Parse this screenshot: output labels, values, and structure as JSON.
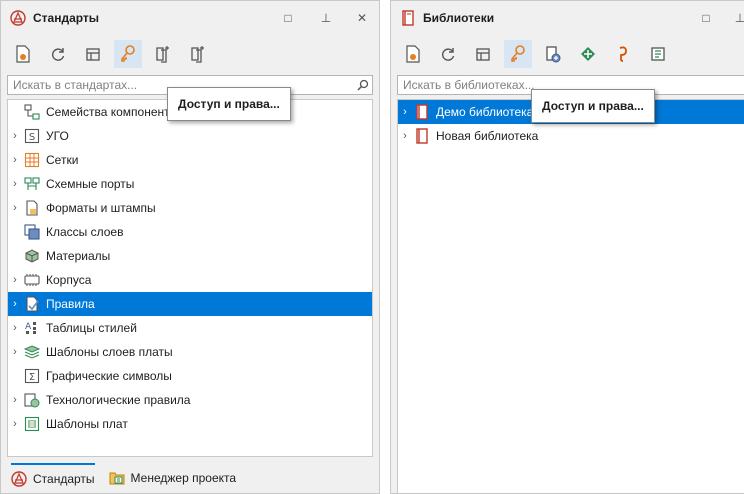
{
  "colors": {
    "accent": "#0078d7",
    "selection": "#0078d7",
    "tooltip_border": "#8a8a8a"
  },
  "left_panel": {
    "title": "Стандарты",
    "title_icon": "standards-icon",
    "window_buttons": {
      "maximize": "□",
      "pin": "⊥",
      "close": "✕"
    },
    "toolbar": [
      "new-icon",
      "refresh-icon",
      "collapse-icon",
      "key-icon",
      "add-standard-icon",
      "add-copy-icon"
    ],
    "search": {
      "placeholder": "Искать в стандартах...",
      "value": ""
    },
    "tree": [
      {
        "label": "Семейства компонентов",
        "expandable": false,
        "icon": "family-icon",
        "selected": false
      },
      {
        "label": "УГО",
        "expandable": true,
        "icon": "symbol-s-icon",
        "selected": false
      },
      {
        "label": "Сетки",
        "expandable": true,
        "icon": "grid-icon",
        "selected": false
      },
      {
        "label": "Схемные порты",
        "expandable": true,
        "icon": "ports-icon",
        "selected": false
      },
      {
        "label": "Форматы и штампы",
        "expandable": true,
        "icon": "format-icon",
        "selected": false
      },
      {
        "label": "Классы слоев",
        "expandable": false,
        "icon": "layer-class-icon",
        "selected": false
      },
      {
        "label": "Материалы",
        "expandable": false,
        "icon": "material-icon",
        "selected": false
      },
      {
        "label": "Корпуса",
        "expandable": true,
        "icon": "package-icon",
        "selected": false
      },
      {
        "label": "Правила",
        "expandable": true,
        "icon": "rules-icon",
        "selected": true
      },
      {
        "label": "Таблицы стилей",
        "expandable": true,
        "icon": "style-table-icon",
        "selected": false
      },
      {
        "label": "Шаблоны слоев платы",
        "expandable": true,
        "icon": "layer-stack-icon",
        "selected": false
      },
      {
        "label": "Графические символы",
        "expandable": false,
        "icon": "sigma-icon",
        "selected": false
      },
      {
        "label": "Технологические правила",
        "expandable": true,
        "icon": "tech-rules-icon",
        "selected": false
      },
      {
        "label": "Шаблоны плат",
        "expandable": true,
        "icon": "board-template-icon",
        "selected": false
      }
    ],
    "tooltip": "Доступ и права...",
    "tabs": [
      {
        "label": "Стандарты",
        "icon": "standards-icon",
        "active": true
      },
      {
        "label": "Менеджер проекта",
        "icon": "project-manager-icon",
        "active": false
      }
    ]
  },
  "right_panel": {
    "title": "Библиотеки",
    "title_icon": "library-icon",
    "window_buttons": {
      "maximize": "□",
      "pin": "⊥"
    },
    "toolbar": [
      "new-icon",
      "refresh-icon",
      "collapse-icon",
      "key-icon",
      "add-library-icon",
      "component-icon",
      "hook-icon",
      "document-icon"
    ],
    "search": {
      "placeholder": "Искать в библиотеках...",
      "value": ""
    },
    "tree": [
      {
        "label": "Демо библиотека",
        "expandable": true,
        "icon": "library-icon",
        "selected": true
      },
      {
        "label": "Новая библиотека",
        "expandable": true,
        "icon": "library-icon",
        "selected": false
      }
    ],
    "tooltip": "Доступ и права..."
  }
}
